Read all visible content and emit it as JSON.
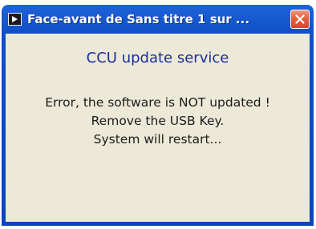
{
  "window": {
    "title": "Face-avant de Sans titre 1 sur ...",
    "icon": "labview-front-panel-icon",
    "close_icon": "close-x-icon"
  },
  "content": {
    "heading": "CCU update service",
    "message_lines": [
      "Error, the software is NOT updated !",
      "Remove the USB Key.",
      "System will restart..."
    ]
  },
  "colors": {
    "titlebar": "#0f4fc8",
    "client_background": "#ece9d8",
    "heading_text": "#1a2f9a",
    "close_button": "#e2603c"
  }
}
